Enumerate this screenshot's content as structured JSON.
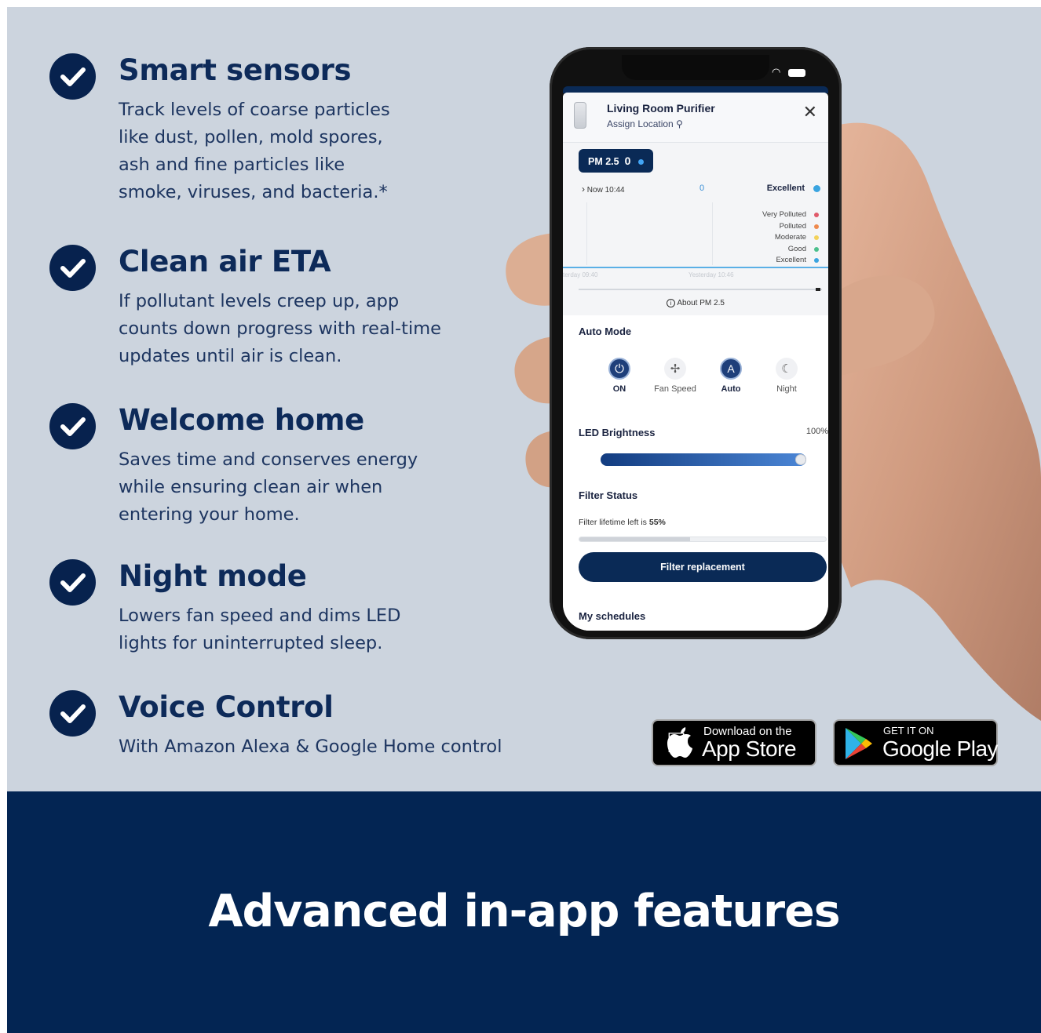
{
  "features": [
    {
      "title": "Smart sensors",
      "body": "Track levels of coarse particles\nlike dust, pollen, mold spores,\nash and fine particles like\nsmoke, viruses, and bacteria.*"
    },
    {
      "title": "Clean air ETA",
      "body": "If pollutant levels creep up, app\ncounts down progress with real-time\nupdates until air is clean."
    },
    {
      "title": "Welcome home",
      "body": "Saves time and conserves energy\nwhile ensuring clean air when\nentering your home."
    },
    {
      "title": "Night mode",
      "body": "Lowers fan speed and dims LED\nlights for uninterrupted sleep."
    },
    {
      "title": "Voice Control",
      "body": "With Amazon Alexa & Google Home control"
    }
  ],
  "app": {
    "device_name": "Living Room Purifier",
    "assign_location": "Assign Location",
    "pm_label": "PM 2.5",
    "pm_value": "0",
    "now_label": "Now 10:44",
    "now_value": "0",
    "quality": "Excellent",
    "legend": [
      {
        "label": "Very Polluted",
        "color": "#e05a6a"
      },
      {
        "label": "Polluted",
        "color": "#ef8a4e"
      },
      {
        "label": "Moderate",
        "color": "#f3d25a"
      },
      {
        "label": "Good",
        "color": "#4cc08c"
      },
      {
        "label": "Excellent",
        "color": "#3aa4e0"
      }
    ],
    "tick_left": "terday 09:40",
    "tick_right": "Yesterday 10:46",
    "about": "About PM 2.5",
    "auto_mode_title": "Auto Mode",
    "modes": [
      {
        "label": "ON",
        "icon": "⏻"
      },
      {
        "label": "Fan Speed",
        "icon": "✢"
      },
      {
        "label": "Auto",
        "icon": "Ⓐ"
      },
      {
        "label": "Night",
        "icon": "☾"
      }
    ],
    "led_title": "LED Brightness",
    "led_value": "100%",
    "led_level": 100,
    "filter_title": "Filter Status",
    "filter_text": "Filter lifetime left is",
    "filter_value": "55%",
    "filter_level": 45,
    "filter_button": "Filter replacement",
    "schedules": "My schedules"
  },
  "stores": {
    "apple_small": "Download on the",
    "apple_big": "App Store",
    "google_small": "GET IT ON",
    "google_big": "Google Play"
  },
  "banner": "Advanced in-app features",
  "colors": {
    "navy": "#032553",
    "panel": "#ccd4de",
    "accent": "#0a2a56"
  }
}
